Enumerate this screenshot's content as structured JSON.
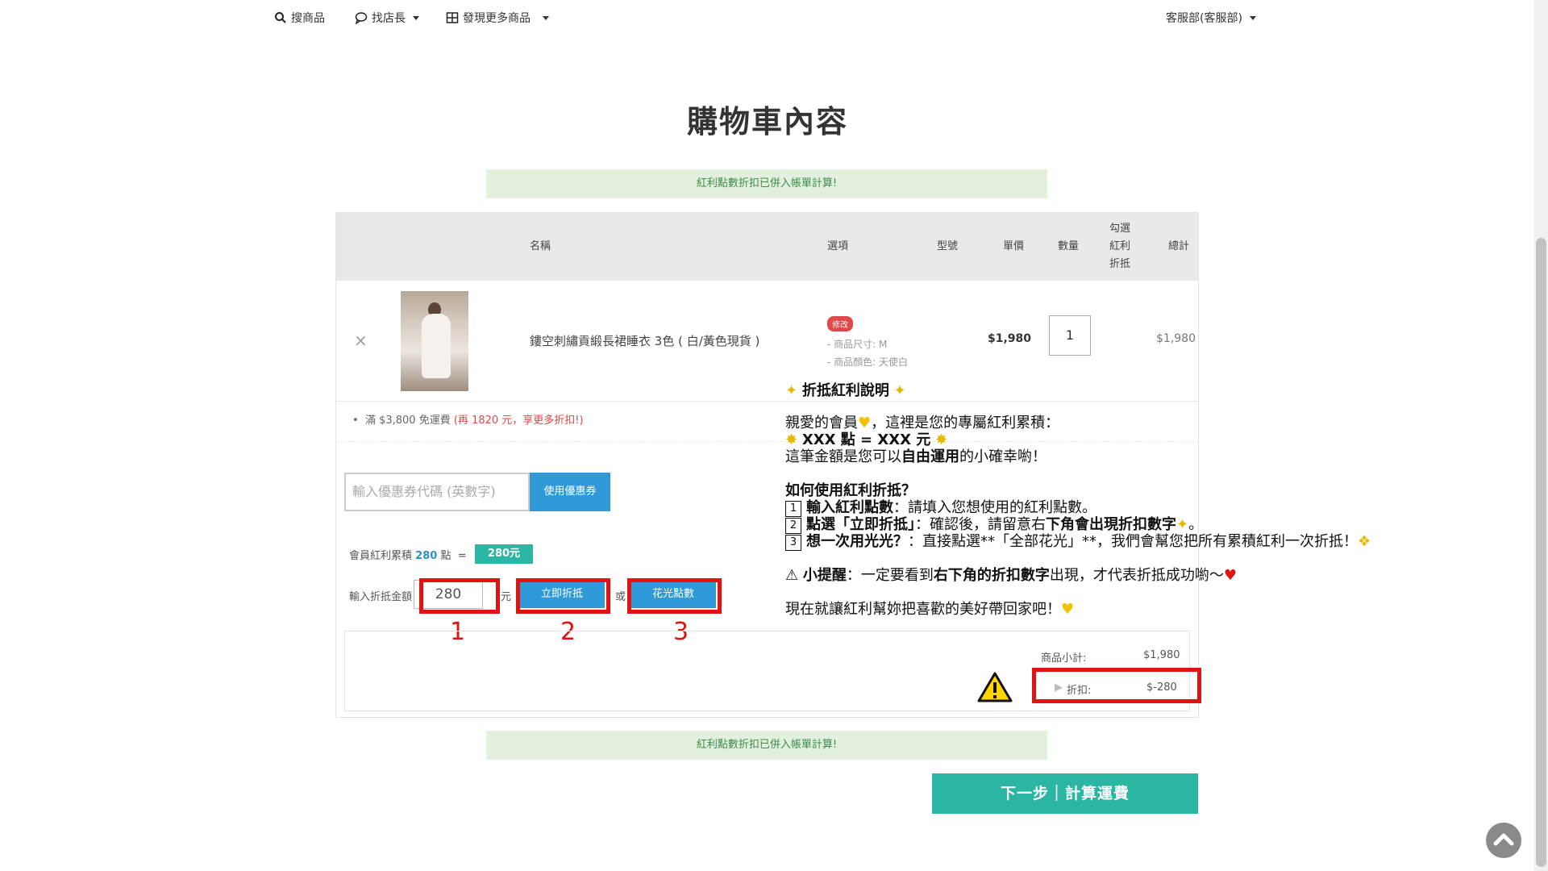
{
  "nav": {
    "search": "搜商品",
    "find_manager": "找店長",
    "discover": "發現更多商品",
    "account": "客服部(客服部)"
  },
  "page_title": "購物車內容",
  "notice_text": "紅利點數折扣已併入帳單計算!",
  "table_headers": {
    "name": "名稱",
    "option": "選項",
    "model": "型號",
    "unit_price": "單價",
    "quantity": "數量",
    "bonus_select": [
      "勾選",
      "紅利",
      "折抵"
    ],
    "total": "總計"
  },
  "item": {
    "remove": "×",
    "name": "鏤空刺繡貢緞長裙睡衣 3色 ( 白/黃色現貨 )",
    "tag": "修改",
    "size": "- 商品尺寸: M",
    "color": "- 商品顏色: 天使白",
    "price": "$1,980",
    "qty": "1",
    "total": "$1,980"
  },
  "shipping": {
    "text": "滿 $3,800 免運費",
    "extra": "(再 1820 元，享更多折扣!)"
  },
  "coupon": {
    "placeholder": "輸入優惠券代碼 (英數字)",
    "button": "使用優惠券"
  },
  "points": {
    "prefix": "會員紅利累積",
    "amount": "280",
    "suffix": "點",
    "equals": "=",
    "badge": "280元"
  },
  "redeem": {
    "label": "輸入折抵金額",
    "value": "280",
    "unit": "元",
    "apply": "立即折抵",
    "or": "或",
    "all": "花光點數"
  },
  "markers": [
    "1",
    "2",
    "3"
  ],
  "summary": {
    "subtotal_label": "商品小計:",
    "subtotal_value": "$1,980",
    "discount_label": "折扣:",
    "discount_value": "$-280"
  },
  "next_button": "下一步｜計算運費",
  "explain": {
    "title": "折抵紅利說明",
    "l1a": "親愛的會員",
    "l1b": "，這裡是您的專屬紅利累積：",
    "l2": "XXX 點 = XXX 元",
    "l3a": "這筆金額是您可以",
    "l3b": "自由運用",
    "l3c": "的小確幸喲！",
    "howto": "如何使用紅利折抵？",
    "s1a": "輸入紅利點數",
    "s1b": "：請填入您想使用的紅利點數。",
    "s2a": "點選「立即折抵」",
    "s2b": "：確認後，請留意右",
    "s2c": "下角會出現折扣數字",
    "s2d": "。",
    "s3a": "想一次用光光？",
    "s3b": "：直接點選**「全部花光」**，我們會幫您把所有累積紅利一次折抵！",
    "tip_a": "小提醒",
    "tip_b": "：一定要看到",
    "tip_c": "右下角的折扣數字",
    "tip_d": "出現，才代表折抵成功喲～",
    "closing": "現在就讓紅利幫妳把喜歡的美好帶回家吧！"
  }
}
